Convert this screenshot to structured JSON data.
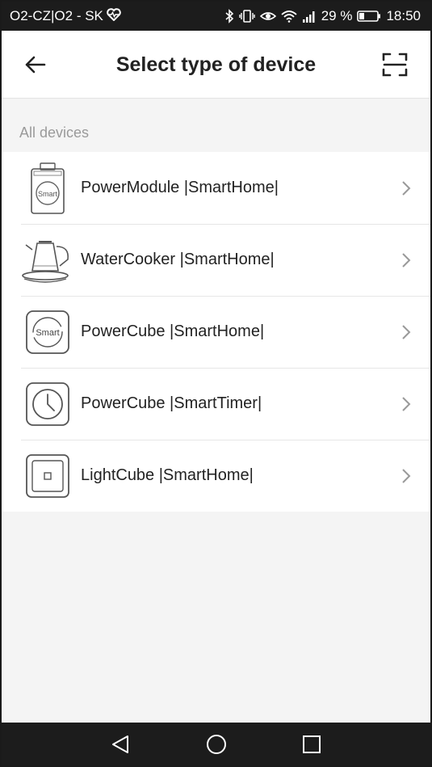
{
  "status_bar": {
    "carrier": "O2-CZ|O2 - SK",
    "battery": "29 %",
    "time": "18:50"
  },
  "header": {
    "title": "Select type of device",
    "back_icon": "arrow-left-icon",
    "scan_icon": "scan-frame-icon"
  },
  "section": {
    "label": "All devices"
  },
  "devices": [
    {
      "label": "PowerModule |SmartHome|",
      "icon": "power-module-icon",
      "icon_text": "Smart"
    },
    {
      "label": "WaterCooker |SmartHome|",
      "icon": "kettle-icon"
    },
    {
      "label": "PowerCube |SmartHome|",
      "icon": "power-cube-smart-icon",
      "icon_text": "Smart"
    },
    {
      "label": "PowerCube |SmartTimer|",
      "icon": "timer-cube-icon"
    },
    {
      "label": "LightCube |SmartHome|",
      "icon": "light-cube-icon"
    }
  ],
  "nav_bar": {
    "buttons": [
      "back-triangle-icon",
      "home-circle-icon",
      "recents-square-icon"
    ]
  },
  "colors": {
    "status_bar_bg": "#1c1c1c",
    "page_bg": "#f4f4f4",
    "title_text": "#222222",
    "section_label": "#9a9a9a"
  }
}
